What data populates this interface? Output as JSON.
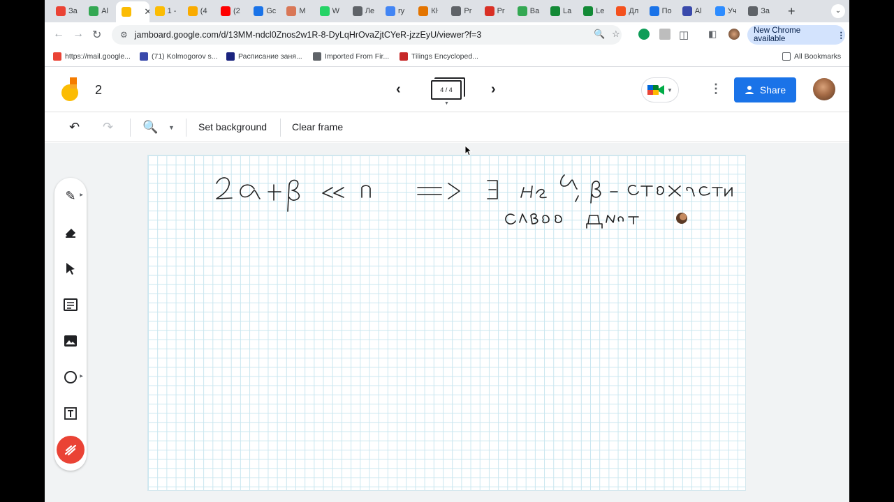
{
  "browser": {
    "tabs": [
      {
        "label": "За",
        "icon": "gmail-icon",
        "color": "#ea4335"
      },
      {
        "label": "Al",
        "icon": "drive-icon",
        "color": "#34a853"
      },
      {
        "label": "",
        "icon": "jamboard-icon",
        "color": "#fbbc04",
        "active": true
      },
      {
        "label": "1 -",
        "icon": "jamboard-icon",
        "color": "#fbbc04"
      },
      {
        "label": "(4",
        "icon": "onec-icon",
        "color": "#f9ab00"
      },
      {
        "label": "(2",
        "icon": "youtube-icon",
        "color": "#ff0000"
      },
      {
        "label": "Gc",
        "icon": "calendar-icon",
        "color": "#1a73e8"
      },
      {
        "label": "M",
        "icon": "claude-icon",
        "color": "#d97757"
      },
      {
        "label": "W",
        "icon": "whatsapp-icon",
        "color": "#25d366"
      },
      {
        "label": "Ле",
        "icon": "person-icon",
        "color": "#5f6368"
      },
      {
        "label": "ry",
        "icon": "google-icon",
        "color": "#4285f4"
      },
      {
        "label": "Кŀ",
        "icon": "coin-icon",
        "color": "#e37400"
      },
      {
        "label": "Pr",
        "icon": "globe-icon",
        "color": "#5f6368"
      },
      {
        "label": "Pr",
        "icon": "acrobat-icon",
        "color": "#d93025"
      },
      {
        "label": "Ba",
        "icon": "leaf-icon",
        "color": "#34a853"
      },
      {
        "label": "La",
        "icon": "overleaf-icon",
        "color": "#138a36"
      },
      {
        "label": "Le",
        "icon": "overleaf-icon",
        "color": "#138a36"
      },
      {
        "label": "Дл",
        "icon": "slides-icon",
        "color": "#f4511e"
      },
      {
        "label": "По",
        "icon": "docs-icon",
        "color": "#1a73e8"
      },
      {
        "label": "Al",
        "icon": "puzzle-icon",
        "color": "#3949ab"
      },
      {
        "label": "Уч",
        "icon": "zoom-icon",
        "color": "#2d8cff"
      },
      {
        "label": "За",
        "icon": "globe-icon",
        "color": "#5f6368"
      }
    ],
    "url": "jamboard.google.com/d/13MM-ndcl0Znos2w1R-8-DyLqHrOvaZjtCYeR-jzzEyU/viewer?f=3",
    "new_chrome_label": "New Chrome available",
    "bookmarks": [
      {
        "label": "https://mail.google...",
        "icon": "gmail-icon",
        "color": "#ea4335"
      },
      {
        "label": "(71) Kolmogorov s...",
        "icon": "people-icon",
        "color": "#3949ab"
      },
      {
        "label": "Расписание заня...",
        "icon": "hse-icon",
        "color": "#1a237e"
      },
      {
        "label": "Imported From Fir...",
        "icon": "folder-icon",
        "color": "#5f6368"
      },
      {
        "label": "Tilings Encycloped...",
        "icon": "tiling-icon",
        "color": "#c62828"
      }
    ],
    "all_bookmarks_label": "All Bookmarks"
  },
  "jamboard": {
    "title": "2",
    "frame_indicator": "4 / 4",
    "share_label": "Share",
    "actions": {
      "set_background": "Set background",
      "clear_frame": "Clear frame"
    },
    "tools": [
      "pen-icon",
      "eraser-icon",
      "select-icon",
      "sticky-note-icon",
      "image-icon",
      "circle-icon",
      "text-box-icon",
      "laser-icon"
    ],
    "accent_color": "#1a73e8",
    "laser_color": "#ea4335"
  }
}
